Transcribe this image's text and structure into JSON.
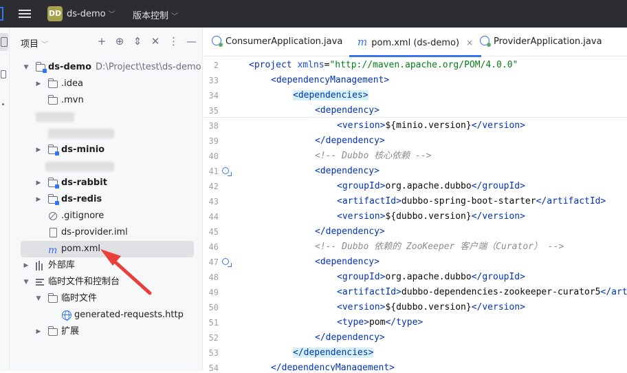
{
  "titlebar": {
    "avatar": "DD",
    "project": "ds-demo",
    "vcs": "版本控制"
  },
  "project_panel": {
    "title": "项目",
    "tools": [
      "+",
      "⊕",
      "⇕",
      "✕",
      "⋮",
      "—"
    ],
    "tree": {
      "root_name": "ds-demo",
      "root_path": "D:\\Project\\test\\ds-demo",
      "idea": ".idea",
      "mvn": ".mvn",
      "minio": "ds-minio",
      "rabbit": "ds-rabbit",
      "redis": "ds-redis",
      "gitignore": ".gitignore",
      "iml": "ds-provider.iml",
      "pom": "pom.xml",
      "external": "外部库",
      "scratches": "临时文件和控制台",
      "scratch_files": "临时文件",
      "generated": "generated-requests.http",
      "extensions": "扩展"
    }
  },
  "editor": {
    "tabs": [
      {
        "label": "ConsumerApplication.java"
      },
      {
        "label": "pom.xml (ds-demo)",
        "close": "×"
      },
      {
        "label": "ProviderApplication.java"
      }
    ],
    "lines": [
      {
        "n": "2",
        "indent": 0,
        "parts": [
          [
            "t",
            "<project "
          ],
          [
            "a",
            "xmlns"
          ],
          [
            "p",
            "="
          ],
          [
            "s",
            "\"http://maven.apache.org/POM/4.0.0\""
          ]
        ]
      },
      {
        "n": "33",
        "indent": 1,
        "parts": [
          [
            "t",
            "<dependencyManagement"
          ],
          [
            "t",
            ">"
          ]
        ]
      },
      {
        "n": "34",
        "indent": 2,
        "hl": true,
        "parts": [
          [
            "t",
            "<dependencies>"
          ]
        ]
      },
      {
        "n": "35",
        "indent": 3,
        "parts": [
          [
            "t",
            "<dependency>"
          ]
        ]
      },
      {
        "n": "38",
        "indent": 4,
        "parts": [
          [
            "t",
            "<version>"
          ],
          [
            "p",
            "${minio.version}"
          ],
          [
            "t",
            "</version>"
          ]
        ]
      },
      {
        "n": "39",
        "indent": 3,
        "parts": [
          [
            "t",
            "</dependency>"
          ]
        ]
      },
      {
        "n": "40",
        "indent": 3,
        "parts": [
          [
            "c",
            "<!-- Dubbo 核心依赖 -->"
          ]
        ]
      },
      {
        "n": "41",
        "indent": 3,
        "icon": true,
        "parts": [
          [
            "t",
            "<dependency>"
          ]
        ]
      },
      {
        "n": "42",
        "indent": 4,
        "parts": [
          [
            "t",
            "<groupId>"
          ],
          [
            "p",
            "org.apache.dubbo"
          ],
          [
            "t",
            "</groupId>"
          ]
        ]
      },
      {
        "n": "43",
        "indent": 4,
        "parts": [
          [
            "t",
            "<artifactId>"
          ],
          [
            "p",
            "dubbo-spring-boot-starter"
          ],
          [
            "t",
            "</artifactId>"
          ]
        ]
      },
      {
        "n": "44",
        "indent": 4,
        "parts": [
          [
            "t",
            "<version>"
          ],
          [
            "p",
            "${dubbo.version}"
          ],
          [
            "t",
            "</version>"
          ]
        ]
      },
      {
        "n": "45",
        "indent": 3,
        "parts": [
          [
            "t",
            "</dependency>"
          ]
        ]
      },
      {
        "n": "46",
        "indent": 3,
        "parts": [
          [
            "c",
            "<!-- Dubbo 依赖的 ZooKeeper 客户端（Curator） -->"
          ]
        ]
      },
      {
        "n": "47",
        "indent": 3,
        "icon": true,
        "parts": [
          [
            "t",
            "<dependency>"
          ]
        ]
      },
      {
        "n": "48",
        "indent": 4,
        "parts": [
          [
            "t",
            "<groupId>"
          ],
          [
            "p",
            "org.apache.dubbo"
          ],
          [
            "t",
            "</groupId>"
          ]
        ]
      },
      {
        "n": "49",
        "indent": 4,
        "parts": [
          [
            "t",
            "<artifactId>"
          ],
          [
            "p",
            "dubbo-dependencies-zookeeper-curator5"
          ],
          [
            "t",
            "</artifactId>"
          ]
        ]
      },
      {
        "n": "50",
        "indent": 4,
        "parts": [
          [
            "t",
            "<version>"
          ],
          [
            "p",
            "${dubbo.version}"
          ],
          [
            "t",
            "</version>"
          ]
        ]
      },
      {
        "n": "51",
        "indent": 4,
        "parts": [
          [
            "t",
            "<type>"
          ],
          [
            "p",
            "pom"
          ],
          [
            "t",
            "</type>"
          ]
        ]
      },
      {
        "n": "52",
        "indent": 3,
        "parts": [
          [
            "t",
            "</dependency>"
          ]
        ]
      },
      {
        "n": "53",
        "indent": 2,
        "hl": true,
        "parts": [
          [
            "t",
            "</dependencies>"
          ]
        ]
      },
      {
        "n": "54",
        "indent": 1,
        "parts": [
          [
            "t",
            "</dependencyManagement>"
          ]
        ]
      }
    ]
  }
}
